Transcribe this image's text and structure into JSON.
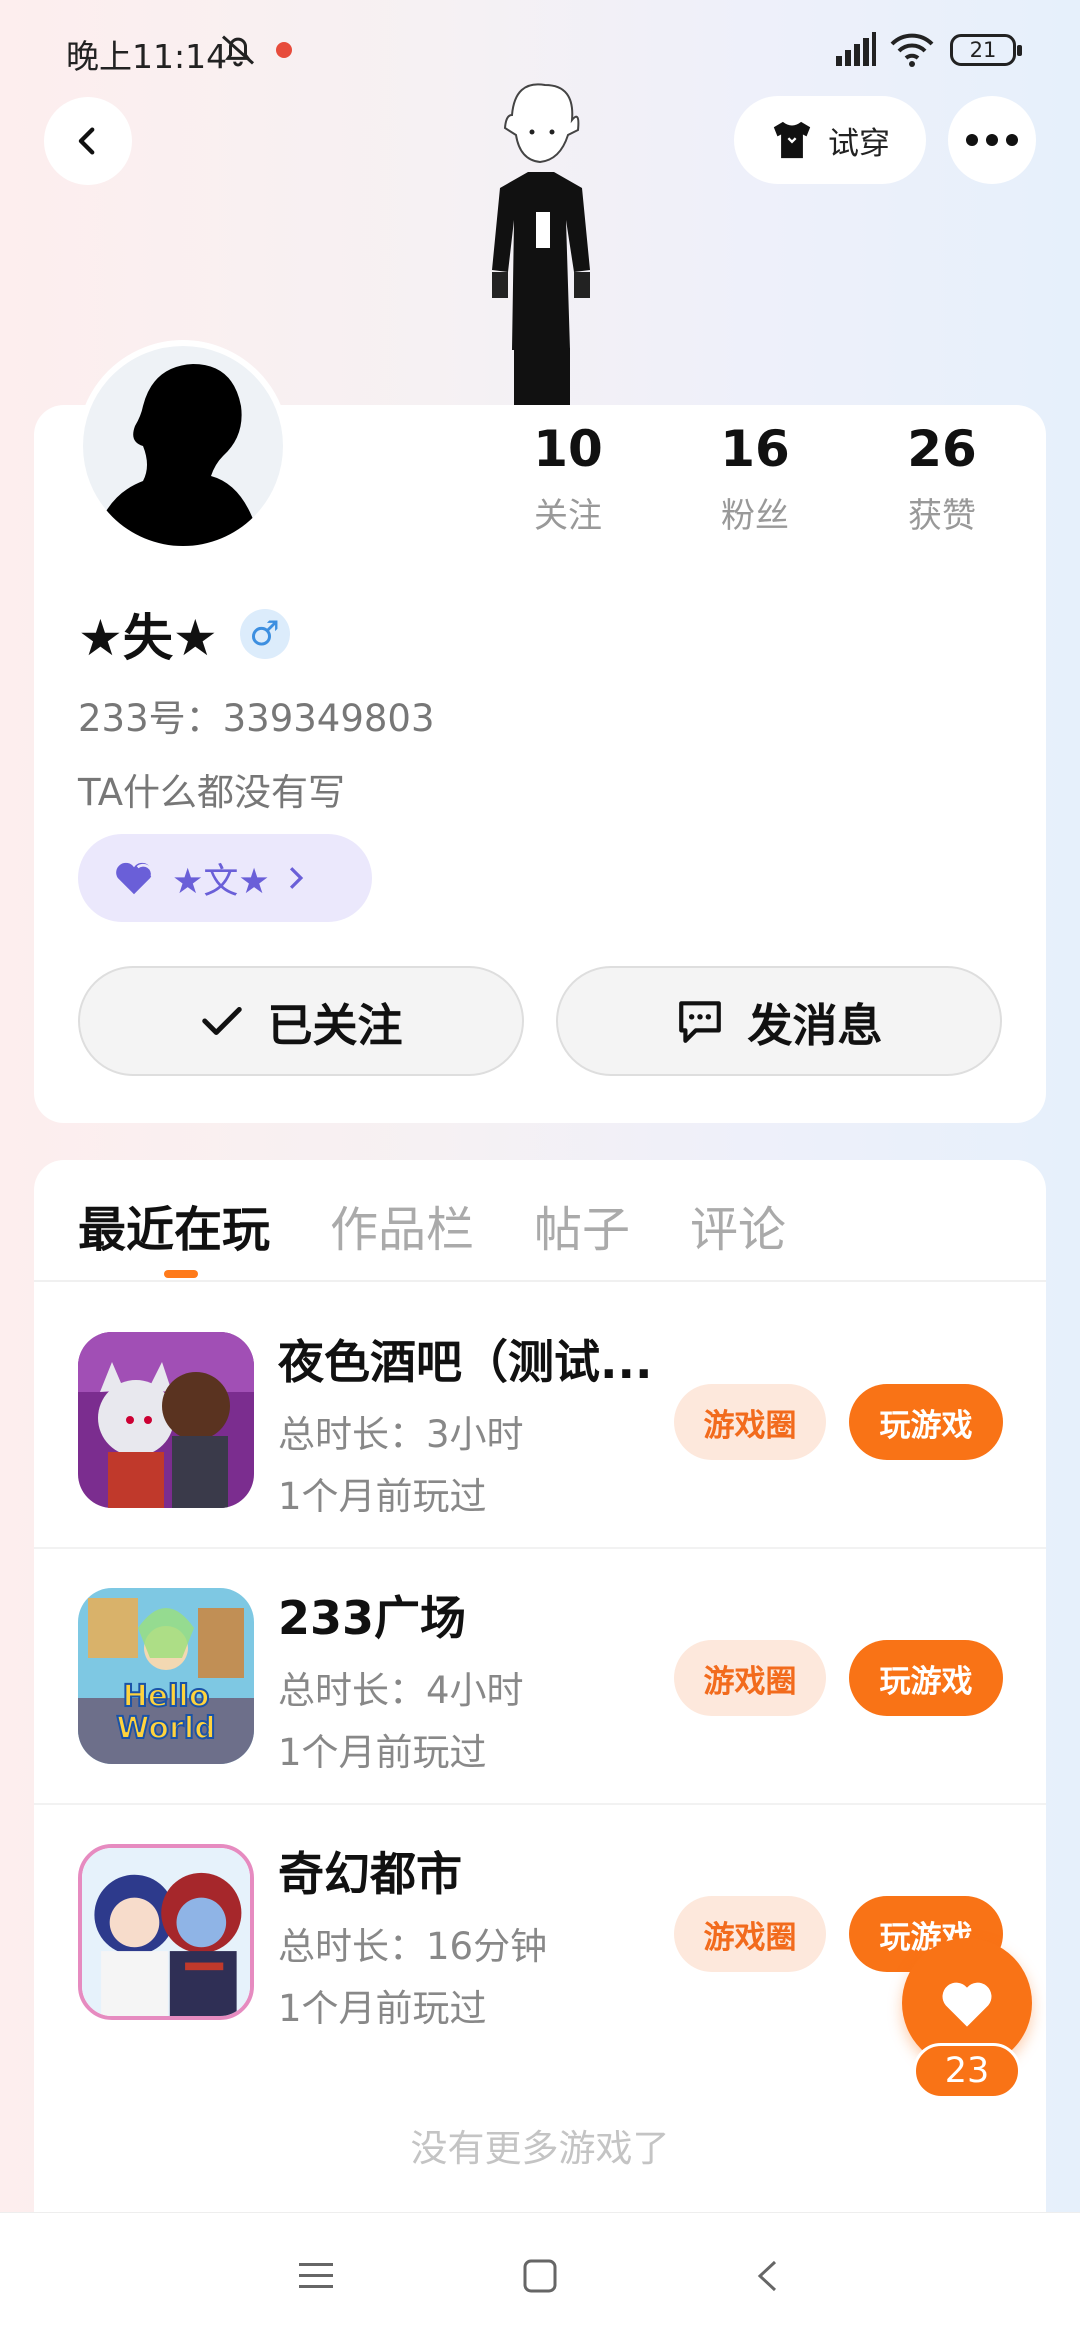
{
  "status_bar": {
    "time": "晚上11:14",
    "battery": "21"
  },
  "header": {
    "try_on_label": "试穿"
  },
  "profile": {
    "stats": [
      {
        "value": "10",
        "label": "关注"
      },
      {
        "value": "16",
        "label": "粉丝"
      },
      {
        "value": "26",
        "label": "获赞"
      }
    ],
    "name": "★失★",
    "gender_symbol": "♂",
    "uid": "233号：339349803",
    "bio": "TA什么都没有写",
    "guild_name": "★文★",
    "follow_button": "已关注",
    "message_button": "发消息"
  },
  "tabs": [
    {
      "label": "最近在玩",
      "active": true
    },
    {
      "label": "作品栏",
      "active": false
    },
    {
      "label": "帖子",
      "active": false
    },
    {
      "label": "评论",
      "active": false
    }
  ],
  "games": [
    {
      "title": "夜色酒吧（测试...",
      "duration": "总时长：3小时",
      "last_played": "1个月前玩过",
      "circle_label": "游戏圈",
      "play_label": "玩游戏"
    },
    {
      "title": "233广场",
      "duration": "总时长：4小时",
      "last_played": "1个月前玩过",
      "circle_label": "游戏圈",
      "play_label": "玩游戏"
    },
    {
      "title": "奇幻都市",
      "duration": "总时长：16分钟",
      "last_played": "1个月前玩过",
      "circle_label": "游戏圈",
      "play_label": "玩游戏"
    }
  ],
  "no_more_text": "没有更多游戏了",
  "like": {
    "count": "23"
  },
  "colors": {
    "accent": "#f97316",
    "accent_light": "#fde8dc",
    "guild_bg": "#ebe8fc",
    "guild_text": "#6a5fd8"
  }
}
